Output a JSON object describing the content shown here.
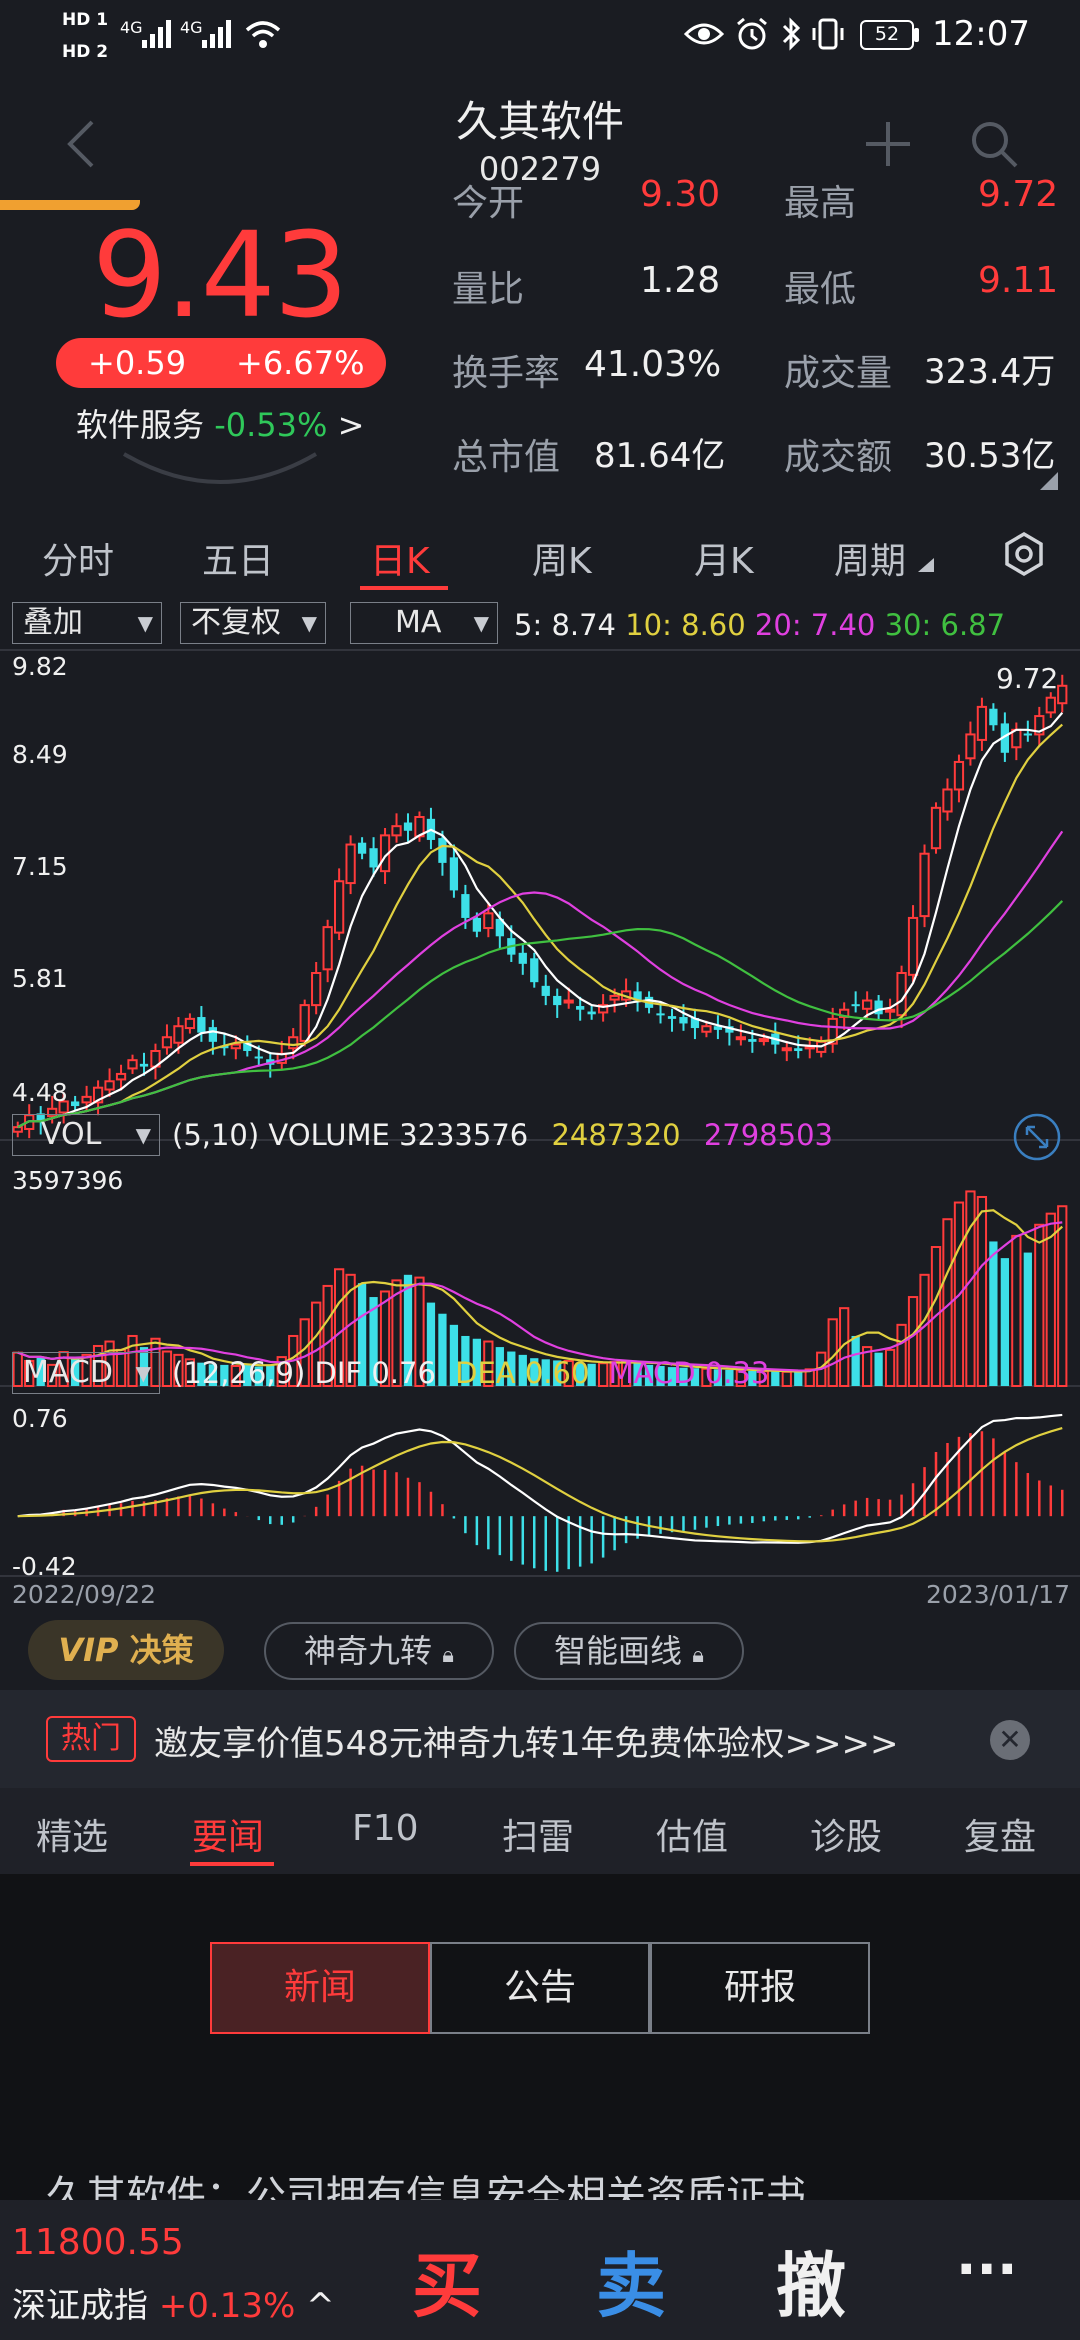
{
  "status": {
    "sim1": "HD 1",
    "sim2": "HD 2",
    "net1": "4G",
    "net2": "4G",
    "battery": "52",
    "time": "12:07"
  },
  "header": {
    "title": "久其软件",
    "code": "002279"
  },
  "quote": {
    "price": "9.43",
    "change": "+0.59",
    "change_pct": "+6.67%",
    "sector_name": "软件服务",
    "sector_pct": "-0.53%",
    "sector_arrow": ">",
    "open_label": "今开",
    "open_value": "9.30",
    "high_label": "最高",
    "high_value": "9.72",
    "ratio_label": "量比",
    "ratio_value": "1.28",
    "low_label": "最低",
    "low_value": "9.11",
    "turnover_label": "换手率",
    "turnover_value": "41.03%",
    "volume_label": "成交量",
    "volume_value": "323.4万",
    "mcap_label": "总市值",
    "mcap_value": "81.64亿",
    "amount_label": "成交额",
    "amount_value": "30.53亿"
  },
  "chart_tabs": [
    "分时",
    "五日",
    "日K",
    "周K",
    "月K",
    "周期"
  ],
  "active_tab": 2,
  "controls": {
    "overlay": "叠加",
    "adjust": "不复权",
    "indicator": "MA"
  },
  "ma_legend": {
    "ma5": "5: 8.74",
    "ma10": "10: 8.60",
    "ma20": "20: 7.40",
    "ma30": "30: 6.87"
  },
  "vol_legend": {
    "selector": "VOL",
    "params": "(5,10) VOLUME",
    "volume": "3233576",
    "ma5": "2487320",
    "ma10": "2798503"
  },
  "macd_legend": {
    "selector": "MACD",
    "params": "(12,26,9) DIF",
    "dif": "0.76",
    "dea_label": "DEA",
    "dea": "0.60",
    "macd_label": "MACD",
    "macd": "0.33"
  },
  "chart_data": {
    "type": "candlestick",
    "price_axis_labels": [
      "9.82",
      "8.49",
      "7.15",
      "5.81",
      "4.48"
    ],
    "price_ylim": [
      4.48,
      9.82
    ],
    "high_marker": "9.72",
    "volume_axis_label": "3597396",
    "volume_ylim": [
      0,
      3597396
    ],
    "macd_axis_labels": [
      "0.76",
      "-0.42"
    ],
    "macd_ylim": [
      -0.42,
      0.76
    ],
    "x_start": "2022/09/22",
    "x_end": "2023/01/17",
    "close": [
      4.62,
      4.75,
      4.68,
      4.82,
      4.9,
      4.85,
      4.95,
      5.05,
      5.12,
      5.2,
      5.35,
      5.28,
      5.45,
      5.6,
      5.72,
      5.8,
      5.65,
      5.55,
      5.48,
      5.52,
      5.45,
      5.38,
      5.3,
      5.42,
      5.6,
      5.95,
      6.3,
      6.8,
      7.3,
      7.7,
      7.6,
      7.45,
      7.8,
      7.9,
      7.85,
      8.0,
      7.75,
      7.5,
      7.2,
      6.9,
      6.75,
      6.95,
      6.7,
      6.5,
      6.4,
      6.2,
      6.05,
      5.95,
      6.0,
      5.9,
      5.85,
      5.95,
      6.05,
      6.1,
      6.0,
      5.92,
      5.85,
      5.8,
      5.75,
      5.7,
      5.72,
      5.68,
      5.65,
      5.6,
      5.55,
      5.58,
      5.52,
      5.48,
      5.45,
      5.5,
      5.55,
      5.8,
      5.9,
      5.95,
      6.0,
      5.85,
      5.9,
      6.3,
      6.9,
      7.6,
      8.1,
      8.3,
      8.6,
      8.9,
      9.2,
      9.0,
      8.7,
      8.95,
      8.9,
      9.1,
      9.3,
      9.43
    ],
    "volume": [
      600000,
      450000,
      520000,
      380000,
      610000,
      500000,
      560000,
      720000,
      800000,
      650000,
      900000,
      700000,
      850000,
      620000,
      560000,
      480000,
      420000,
      390000,
      380000,
      360000,
      400000,
      350000,
      380000,
      520000,
      900000,
      1200000,
      1500000,
      1800000,
      2100000,
      2000000,
      1850000,
      1600000,
      1700000,
      1900000,
      2000000,
      1950000,
      1500000,
      1300000,
      1100000,
      900000,
      850000,
      800000,
      700000,
      620000,
      560000,
      500000,
      480000,
      460000,
      450000,
      420000,
      400000,
      410000,
      430000,
      450000,
      420000,
      380000,
      360000,
      340000,
      330000,
      320000,
      310000,
      300000,
      290000,
      280000,
      270000,
      265000,
      260000,
      255000,
      250000,
      300000,
      600000,
      1200000,
      1400000,
      900000,
      700000,
      600000,
      650000,
      1100000,
      1600000,
      2000000,
      2500000,
      3000000,
      3300000,
      3500000,
      3400000,
      2600000,
      2300000,
      2700000,
      2400000,
      2900000,
      3100000,
      3233576
    ]
  },
  "toolbar": {
    "vip": "VIP",
    "vip_label": "决策",
    "tool1": "神奇九转",
    "tool2": "智能画线"
  },
  "hot": {
    "tag": "热门",
    "text": "邀友享价值548元神奇九转1年免费体验权>>>>"
  },
  "subtabs": [
    "精选",
    "要闻",
    "F10",
    "扫雷",
    "估值",
    "诊股",
    "复盘"
  ],
  "active_subtab": 1,
  "news_tabs": [
    "新闻",
    "公告",
    "研报"
  ],
  "news_headline": "久其软件：公司拥有信息安全相关资质证书",
  "bottom": {
    "index_value": "11800.55",
    "index_name": "深证成指",
    "index_pct": "+0.13%",
    "buy": "买",
    "sell": "卖",
    "cancel": "撤",
    "more": "···"
  }
}
